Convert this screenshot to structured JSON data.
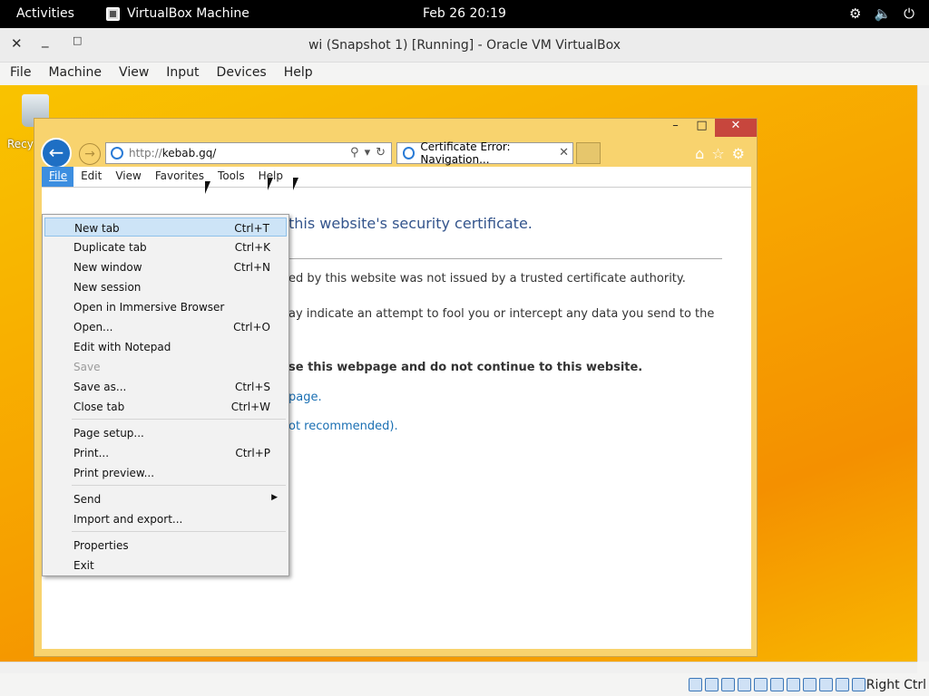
{
  "topbar": {
    "activities": "Activities",
    "app_name": "VirtualBox Machine",
    "clock": "Feb 26  20:19",
    "tray_icons": [
      "network-icon",
      "volume-icon",
      "power-icon"
    ]
  },
  "vbox": {
    "title": "wi (Snapshot 1) [Running] - Oracle VM VirtualBox",
    "menu": [
      "File",
      "Machine",
      "View",
      "Input",
      "Devices",
      "Help"
    ],
    "host_key": "Right Ctrl"
  },
  "desktop": {
    "recycle_label": "Recy"
  },
  "ie": {
    "url_scheme": "http://",
    "url_host": "kebab.gq/",
    "tab_title": "Certificate Error: Navigation...",
    "menu": [
      "File",
      "Edit",
      "View",
      "Favorites",
      "Tools",
      "Help"
    ],
    "content": {
      "heading": "this website's security certificate.",
      "line1": "ed by this website was not issued by a trusted certificate authority.",
      "line2": "ay indicate an attempt to fool you or intercept any data you send to the",
      "line3": "se this webpage and do not continue to this website.",
      "link1": "page.",
      "link2": "ot recommended)."
    }
  },
  "file_menu": {
    "items": [
      {
        "label": "New tab",
        "shortcut": "Ctrl+T"
      },
      {
        "label": "Duplicate tab",
        "shortcut": "Ctrl+K"
      },
      {
        "label": "New window",
        "shortcut": "Ctrl+N"
      },
      {
        "label": "New session",
        "shortcut": ""
      },
      {
        "label": "Open in Immersive Browser",
        "shortcut": ""
      },
      {
        "label": "Open...",
        "shortcut": "Ctrl+O"
      },
      {
        "label": "Edit with Notepad",
        "shortcut": ""
      },
      {
        "label": "Save",
        "shortcut": ""
      },
      {
        "label": "Save as...",
        "shortcut": "Ctrl+S"
      },
      {
        "label": "Close tab",
        "shortcut": "Ctrl+W"
      },
      {
        "label": "Page setup...",
        "shortcut": ""
      },
      {
        "label": "Print...",
        "shortcut": "Ctrl+P"
      },
      {
        "label": "Print preview...",
        "shortcut": ""
      },
      {
        "label": "Send",
        "shortcut": ""
      },
      {
        "label": "Import and export...",
        "shortcut": ""
      },
      {
        "label": "Properties",
        "shortcut": ""
      },
      {
        "label": "Exit",
        "shortcut": ""
      }
    ]
  }
}
